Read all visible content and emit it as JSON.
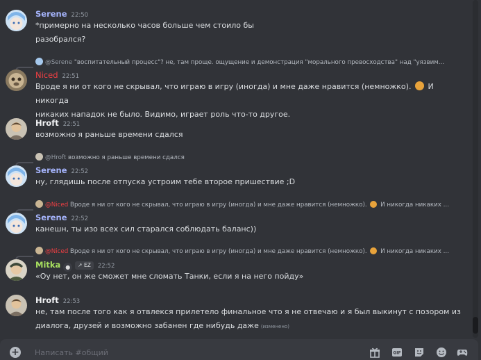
{
  "messages": [
    {
      "author": "Serene",
      "time": "22:50",
      "lines": [
        "*примерно на несколько часов больше чем стоило бы",
        "разобрался?"
      ]
    },
    {
      "reply": {
        "author": "@Serene",
        "text": "\"воспитательный процесс\"? не, там проще. ощущение и демонстрация \"морального превосходства\" над \"уязвим..."
      },
      "author": "Niced",
      "time": "22:51",
      "text_a": "Вроде я ни от кого не скрывал, что играю в игру (иногда) и мне даже нравится (немножко).",
      "text_b": "И никогда",
      "text_c": "никаких нападок не было. Видимо, играет роль что-то другое."
    },
    {
      "author": "Hroft",
      "time": "22:51",
      "lines": [
        "возможно я раньше времени сдался"
      ]
    },
    {
      "reply": {
        "author": "@Hroft",
        "text": "возможно я раньше времени сдался"
      },
      "author": "Serene",
      "time": "22:52",
      "lines": [
        "ну, глядишь после отпуска устроим тебе второе пришествие ;D"
      ]
    },
    {
      "reply": {
        "author": "@Niced",
        "text": "Вроде я ни от кого не скрывал, что играю в игру (иногда) и мне даже нравится (немножко).",
        "tail": "И никогда никаких ..."
      },
      "author": "Serene",
      "time": "22:52",
      "lines": [
        "канешн, ты изо всех сил старался соблюдать баланс))"
      ]
    },
    {
      "reply": {
        "author": "@Niced",
        "text": "Вроде я ни от кого не скрывал, что играю в игру (иногда) и мне даже нравится (немножко).",
        "tail": "И никогда никаких ..."
      },
      "author": "Mitka",
      "tag": "EZ",
      "time": "22:52",
      "lines": [
        "«Оу нет, он же сможет мне сломать Танки, если я на него пойду»"
      ]
    },
    {
      "author": "Hroft",
      "time": "22:53",
      "lines": [
        "не, там после того как я отвлекся прилетело финальное что я не отвечаю и я был выкинут с позором из",
        "диалога, друзей и возможно забанен где нибудь даже"
      ],
      "edited": "(изменено)"
    }
  ],
  "composer": {
    "placeholder": "Написать #общий"
  },
  "icons": [
    "plus-icon",
    "gift-icon",
    "gif-icon",
    "sticker-icon",
    "emoji-icon",
    "gamepad-icon"
  ],
  "colors": {
    "serene": "#a5b4fc",
    "niced": "#f23f43",
    "hroft": "#f2f3f5",
    "mitka": "#a8e05f",
    "background": "#313338"
  }
}
